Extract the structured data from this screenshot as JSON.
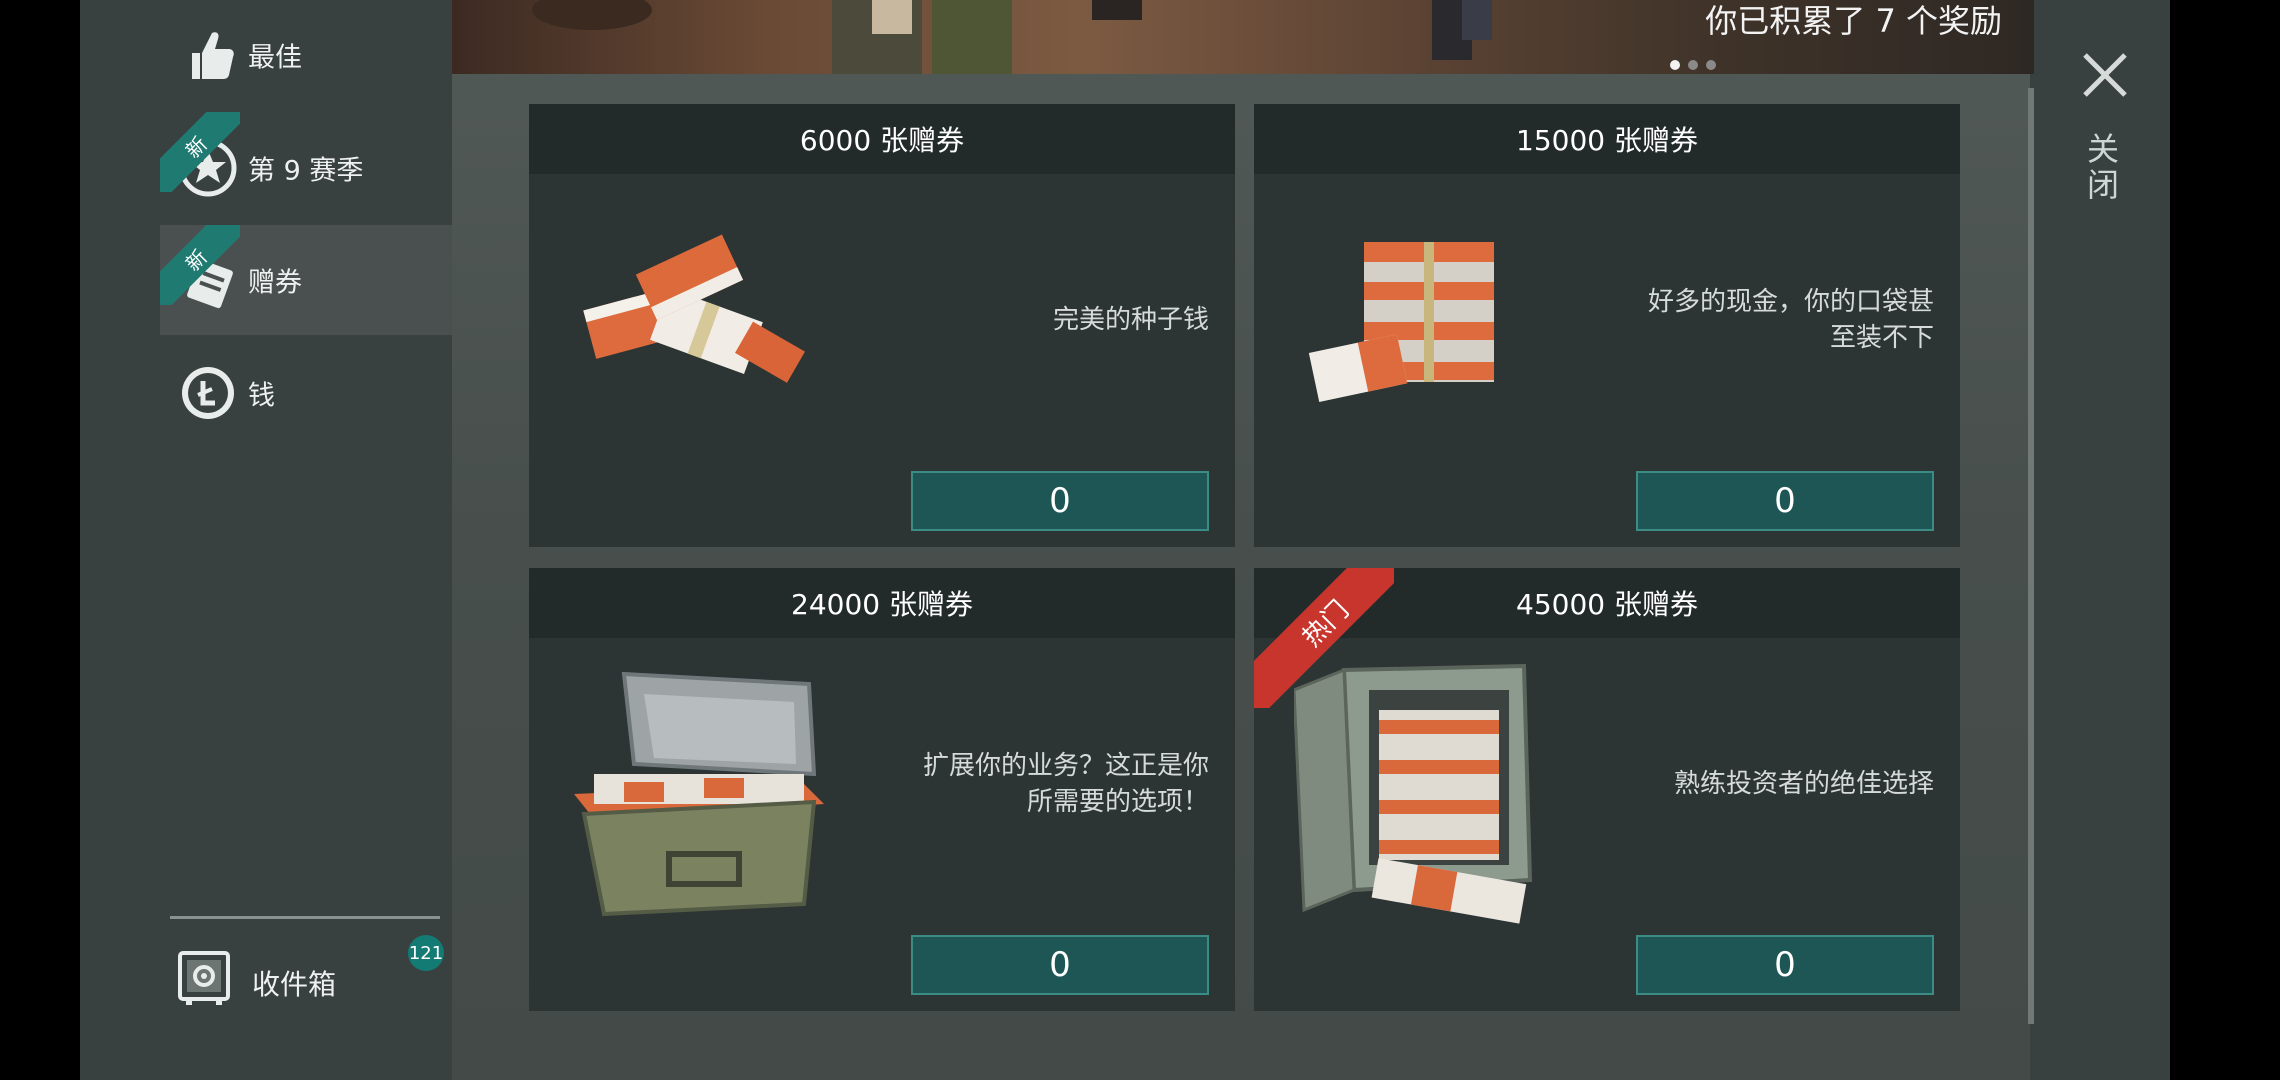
{
  "banner": {
    "text": "你已积累了 7 个奖励",
    "dots": 3,
    "active_dot": 0
  },
  "sidebar": {
    "items": [
      {
        "label": "最佳",
        "icon": "thumbs-up-icon",
        "new": false,
        "active": false
      },
      {
        "label": "第 9 赛季",
        "icon": "season-badge-icon",
        "new": true,
        "active": false
      },
      {
        "label": "赠券",
        "icon": "coupon-icon",
        "new": true,
        "active": true
      },
      {
        "label": "钱",
        "icon": "coin-icon",
        "new": false,
        "active": false
      }
    ],
    "new_label": "新",
    "mailbox": {
      "label": "收件箱",
      "count": "121",
      "icon": "safe-box-icon"
    }
  },
  "cards": [
    {
      "title": "6000 张赠券",
      "desc": [
        "完美的种子钱"
      ],
      "price": "0",
      "hot": false,
      "image": "small-coupon-stack"
    },
    {
      "title": "15000 张赠券",
      "desc": [
        "好多的现金，你的口袋甚",
        "至装不下"
      ],
      "price": "0",
      "hot": false,
      "image": "coupon-pile"
    },
    {
      "title": "24000 张赠券",
      "desc": [
        "扩展你的业务？这正是你",
        "所需要的选项！"
      ],
      "price": "0",
      "hot": false,
      "image": "coupon-case"
    },
    {
      "title": "45000 张赠券",
      "desc": [
        "熟练投资者的绝佳选择"
      ],
      "price": "0",
      "hot": true,
      "hot_label": "热门",
      "image": "coupon-safe"
    }
  ],
  "close": {
    "label": "关闭"
  },
  "colors": {
    "teal": "#1d5654",
    "accent_border": "#3c8c86",
    "hot_red": "#c8352c",
    "new_green": "#1f7a72"
  }
}
